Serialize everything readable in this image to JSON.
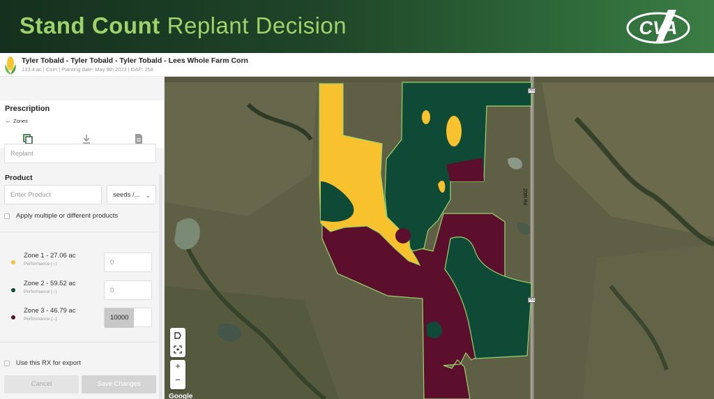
{
  "banner": {
    "title_bold": "Stand Count",
    "title_light": "Replant Decision",
    "logo_text": "CVA"
  },
  "field": {
    "title": "Tyler Tobald - Tyler Tobald - Tyler Tobald - Lees Whole Farm Corn",
    "meta": "133.4 ac | Corn | Planting date: May 9th 2023 | DAP: 258",
    "icon": "corn-icon"
  },
  "sidebar": {
    "heading": "Prescription",
    "back_link": "Zones",
    "tools": [
      "copy-icon",
      "download-icon",
      "file-icon"
    ],
    "replant_value": "Replant",
    "product_label": "Product",
    "product_placeholder": "Enter Product",
    "unit_value": "seeds /...",
    "apply_multiple_label": "Apply multiple or different products",
    "zones": [
      {
        "name": "Zone 1 - 27.06 ac",
        "performance": "Performance (--)",
        "rate": "0",
        "color": "#f8c12e"
      },
      {
        "name": "Zone 2 - 59.52 ac",
        "performance": "Performance (--)",
        "rate": "0",
        "color": "#0e4a36"
      },
      {
        "name": "Zone 3 - 46.79 ac",
        "performance": "Performance (--)",
        "rate": "10000",
        "color": "#5b0f2c"
      }
    ],
    "export_label": "Use this RX for export",
    "cancel_label": "Cancel",
    "save_label": "Save Changes"
  },
  "map": {
    "road_name": "20th Rd",
    "shield_number": "761",
    "attribution": "Google",
    "controls": [
      "draw-icon",
      "focus-icon",
      "zoom-in-button",
      "zoom-out-button"
    ],
    "colors": {
      "zone1": "#f8c12e",
      "zone2": "#0e4a36",
      "zone3": "#5b0f2c",
      "outline": "#9bd46b"
    }
  }
}
